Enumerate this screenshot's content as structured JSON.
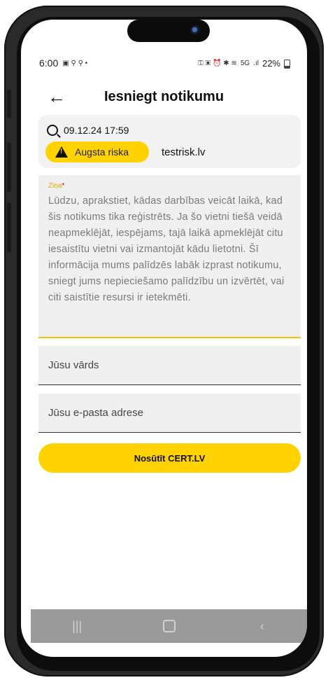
{
  "status_bar": {
    "time": "6:00",
    "battery": "22%",
    "network": "5G"
  },
  "header": {
    "title": "Iesniegt notikumu"
  },
  "incident": {
    "datetime": "09.12.24 17:59",
    "risk_label": "Augsta riska",
    "domain": "testrisk.lv"
  },
  "message": {
    "label": "Ziņa",
    "required_mark": "*",
    "placeholder": "Lūdzu, aprakstiet, kādas darbības veicāt laikā, kad šis notikums tika reģistrēts. Ja šo vietni tiešā veidā neapmeklējāt, iespējams, tajā laikā apmeklējāt citu iesaistītu vietni vai izmantojāt kādu lietotni. Šī informācija mums palīdzēs labāk izprast notikumu, sniegt jums nepieciešamo palīdzību un izvērtēt, vai citi saistītie resursi ir ietekmēti."
  },
  "form": {
    "name_placeholder": "Jūsu vārds",
    "email_placeholder": "Jūsu e-pasta adrese",
    "submit_label": "Nosūtīt CERT.LV"
  },
  "colors": {
    "accent": "#ffd200",
    "navbar": "#9a9a9a",
    "card_bg": "#f2f2f2"
  },
  "icons": {
    "back": "arrow-left-icon",
    "search": "search-icon",
    "warning": "warning-icon",
    "nav_recents": "recents-icon",
    "nav_home": "home-icon",
    "nav_back": "chevron-left-icon"
  }
}
